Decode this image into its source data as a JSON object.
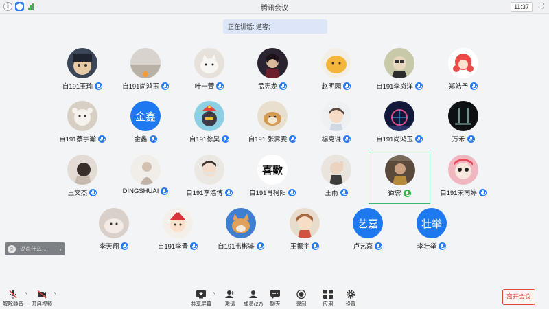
{
  "titlebar": {
    "title": "腾讯会议",
    "clock": "11:37",
    "icons": [
      "info-icon",
      "shield-icon",
      "signal-icon",
      "fullscreen-icon"
    ]
  },
  "banner": {
    "speaking": "正在讲话: 道容;"
  },
  "participants": [
    {
      "name": "自191王瑜"
    },
    {
      "name": "自191尚鸿玉"
    },
    {
      "name": "叶一萱"
    },
    {
      "name": "孟宪龙"
    },
    {
      "name": "赵明园"
    },
    {
      "name": "自191李岚洋"
    },
    {
      "name": "郑皓予"
    },
    {
      "name": "自191蔡宇瀚"
    },
    {
      "name": "金鑫",
      "avatar_text": "金鑫"
    },
    {
      "name": "自191徐昊"
    },
    {
      "name": "自191 张霁雯"
    },
    {
      "name": "楊克谦"
    },
    {
      "name": "自191尚鸿玉"
    },
    {
      "name": "万禾"
    },
    {
      "name": "王文杰"
    },
    {
      "name": "DINGSHUAI"
    },
    {
      "name": "自191李浩博"
    },
    {
      "name": "自191肖柯阳",
      "avatar_text": "喜歡"
    },
    {
      "name": "王雨"
    },
    {
      "name": "道容",
      "speaking": true
    },
    {
      "name": "自191宋南婷"
    },
    {
      "name": "李天翔"
    },
    {
      "name": "自191李晋"
    },
    {
      "name": "自191韦彬鉴"
    },
    {
      "name": "王振宇"
    },
    {
      "name": "卢艺嘉",
      "avatar_text": "艺嘉"
    },
    {
      "name": "李壮举",
      "avatar_text": "壮举"
    }
  ],
  "chat": {
    "placeholder": "说点什么..."
  },
  "toolbar": {
    "mute": "解除静音",
    "video": "开启视频",
    "share": "共享屏幕",
    "invite": "邀请",
    "members": "成员(27)",
    "chat": "聊天",
    "record": "录制",
    "apps": "应用",
    "settings": "设置",
    "leave": "离开会议"
  },
  "colors": {
    "accent": "#1e78f0",
    "mic": "#2b7bf2",
    "speaking": "#39b54a",
    "active_border": "#3cb873",
    "leave": "#e1443b",
    "banner": "#dce6f8"
  }
}
